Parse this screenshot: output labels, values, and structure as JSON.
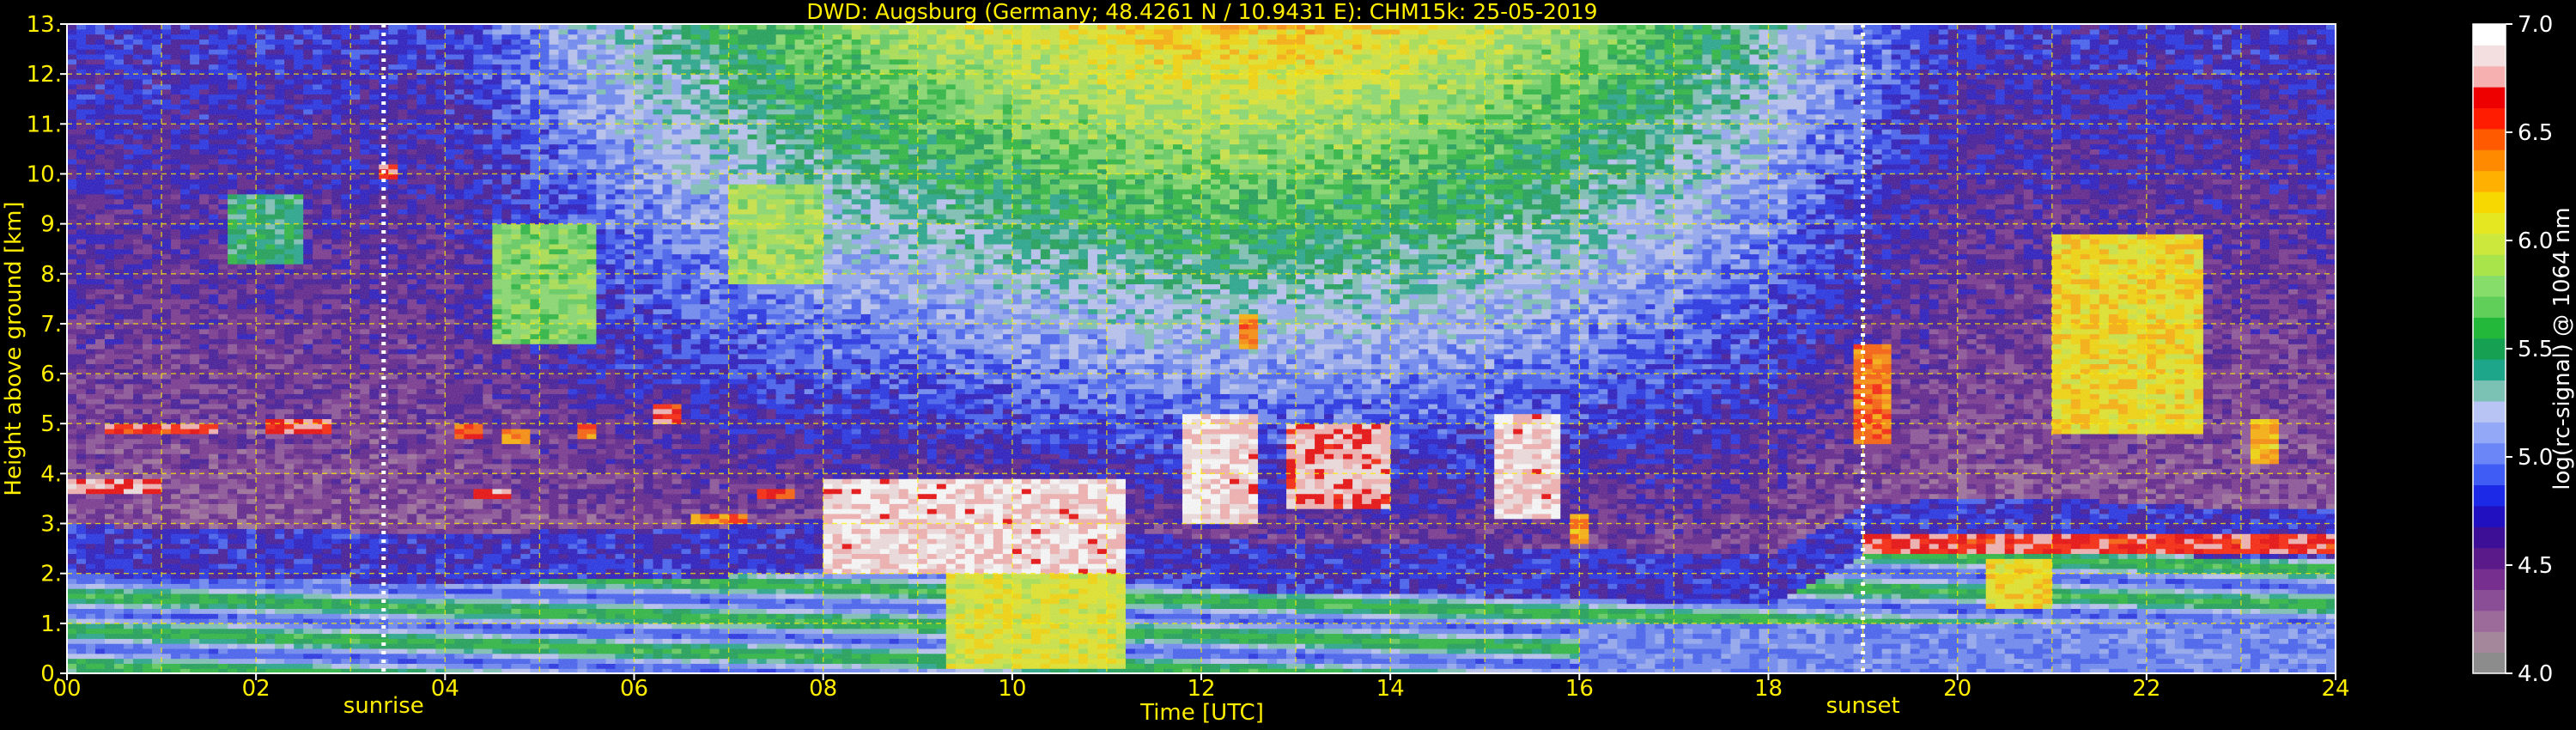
{
  "chart_data": {
    "type": "heatmap",
    "title": "DWD: Augsburg (Germany; 48.4261 N / 10.9431 E):    CHM15k: 25-05-2019",
    "xlabel": "Time [UTC]",
    "ylabel": "Height above ground [km]",
    "xlim": [
      0,
      24
    ],
    "ylim": [
      0,
      13
    ],
    "x_ticks": [
      "00",
      "02",
      "04",
      "06",
      "08",
      "10",
      "12",
      "14",
      "16",
      "18",
      "20",
      "22",
      "24"
    ],
    "y_ticks": [
      "0.",
      "1.",
      "2.",
      "3.",
      "4.",
      "5.",
      "6.",
      "7.",
      "8.",
      "9.",
      "10.",
      "11.",
      "12.",
      "13."
    ],
    "grid": true,
    "colorbar": {
      "label": "log(rc-signal) @ 1064 nm",
      "range": [
        4.0,
        7.0
      ],
      "ticks": [
        "4.0",
        "4.5",
        "5.0",
        "5.5",
        "6.0",
        "6.5",
        "7.0"
      ],
      "colors": [
        "#8c8c8c",
        "#a5879b",
        "#9c6b9a",
        "#8a4e97",
        "#762f8e",
        "#5a1a8a",
        "#3c0f96",
        "#2010c0",
        "#1c2ae8",
        "#3f5cf5",
        "#6a86f7",
        "#93a8f6",
        "#b8c4f4",
        "#7bc2b5",
        "#1ea68a",
        "#15a052",
        "#24b83a",
        "#5fcf5a",
        "#86dd6a",
        "#a9e44b",
        "#cce83d",
        "#e5e821",
        "#f7d800",
        "#ffb000",
        "#ff8a00",
        "#ff5a00",
        "#ff1c00",
        "#ee0000",
        "#f6b0b0",
        "#f3dfe0",
        "#ffffff"
      ]
    },
    "markers": [
      {
        "label": "sunrise",
        "x": 3.35
      },
      {
        "label": "sunset",
        "x": 19.0
      }
    ],
    "structures": {
      "boundary_layer_top": [
        [
          0,
          2.0
        ],
        [
          1,
          1.9
        ],
        [
          2,
          1.9
        ],
        [
          3,
          1.85
        ],
        [
          4,
          1.8
        ],
        [
          5,
          1.85
        ],
        [
          6,
          1.9
        ],
        [
          7,
          1.95
        ],
        [
          8,
          2.1
        ],
        [
          9,
          2.3
        ],
        [
          10,
          2.1
        ],
        [
          11,
          1.9
        ],
        [
          12,
          1.7
        ],
        [
          13,
          1.6
        ],
        [
          14,
          1.6
        ],
        [
          15,
          1.55
        ],
        [
          16,
          1.5
        ],
        [
          17,
          1.4
        ],
        [
          18,
          1.35
        ],
        [
          19,
          2.4
        ],
        [
          20,
          2.5
        ],
        [
          21,
          2.5
        ],
        [
          22,
          2.4
        ],
        [
          23,
          2.3
        ],
        [
          24,
          2.3
        ]
      ],
      "cloud_layers": [
        {
          "x0": 0.0,
          "x1": 1.0,
          "y0": 3.6,
          "y1": 3.9,
          "v": 6.9
        },
        {
          "x0": 0.4,
          "x1": 1.6,
          "y0": 4.8,
          "y1": 5.0,
          "v": 6.8
        },
        {
          "x0": 2.1,
          "x1": 2.8,
          "y0": 4.8,
          "y1": 5.1,
          "v": 6.8
        },
        {
          "x0": 3.3,
          "x1": 3.5,
          "y0": 9.9,
          "y1": 10.2,
          "v": 6.8
        },
        {
          "x0": 4.1,
          "x1": 4.4,
          "y0": 4.7,
          "y1": 5.0,
          "v": 6.7
        },
        {
          "x0": 4.6,
          "x1": 4.9,
          "y0": 4.6,
          "y1": 4.9,
          "v": 6.5
        },
        {
          "x0": 5.4,
          "x1": 5.6,
          "y0": 4.7,
          "y1": 5.0,
          "v": 6.6
        },
        {
          "x0": 6.2,
          "x1": 6.5,
          "y0": 5.0,
          "y1": 5.4,
          "v": 6.8
        },
        {
          "x0": 4.3,
          "x1": 4.7,
          "y0": 3.5,
          "y1": 3.7,
          "v": 6.9
        },
        {
          "x0": 6.6,
          "x1": 7.2,
          "y0": 3.0,
          "y1": 3.2,
          "v": 6.6
        },
        {
          "x0": 7.3,
          "x1": 7.7,
          "y0": 3.5,
          "y1": 3.7,
          "v": 6.7
        },
        {
          "x0": 8.0,
          "x1": 11.2,
          "y0": 2.0,
          "y1": 3.9,
          "v": 7.0
        },
        {
          "x0": 9.3,
          "x1": 11.2,
          "y0": 0.1,
          "y1": 2.0,
          "v": 6.2
        },
        {
          "x0": 11.8,
          "x1": 12.6,
          "y0": 3.0,
          "y1": 5.2,
          "v": 7.0
        },
        {
          "x0": 12.9,
          "x1": 14.0,
          "y0": 3.3,
          "y1": 5.0,
          "v": 6.9
        },
        {
          "x0": 12.4,
          "x1": 12.6,
          "y0": 6.5,
          "y1": 7.2,
          "v": 6.6
        },
        {
          "x0": 15.1,
          "x1": 15.8,
          "y0": 3.1,
          "y1": 5.2,
          "v": 7.0
        },
        {
          "x0": 15.9,
          "x1": 16.1,
          "y0": 2.6,
          "y1": 3.2,
          "v": 6.5
        },
        {
          "x0": 18.9,
          "x1": 19.3,
          "y0": 4.6,
          "y1": 6.6,
          "v": 6.6
        },
        {
          "x0": 19.0,
          "x1": 24.0,
          "y0": 2.4,
          "y1": 2.8,
          "v": 6.8
        },
        {
          "x0": 20.3,
          "x1": 21.0,
          "y0": 1.3,
          "y1": 2.3,
          "v": 6.3
        },
        {
          "x0": 21.0,
          "x1": 22.6,
          "y0": 4.8,
          "y1": 8.8,
          "v": 6.3
        },
        {
          "x0": 22.4,
          "x1": 22.6,
          "y0": 5.0,
          "y1": 6.8,
          "v": 6.1
        },
        {
          "x0": 23.1,
          "x1": 23.4,
          "y0": 4.2,
          "y1": 5.1,
          "v": 6.4
        },
        {
          "x0": 4.5,
          "x1": 5.6,
          "y0": 6.6,
          "y1": 9.0,
          "v": 5.9
        },
        {
          "x0": 7.0,
          "x1": 8.0,
          "y0": 7.8,
          "y1": 9.8,
          "v": 6.0
        },
        {
          "x0": 1.7,
          "x1": 2.5,
          "y0": 8.2,
          "y1": 9.6,
          "v": 5.6
        }
      ]
    }
  }
}
